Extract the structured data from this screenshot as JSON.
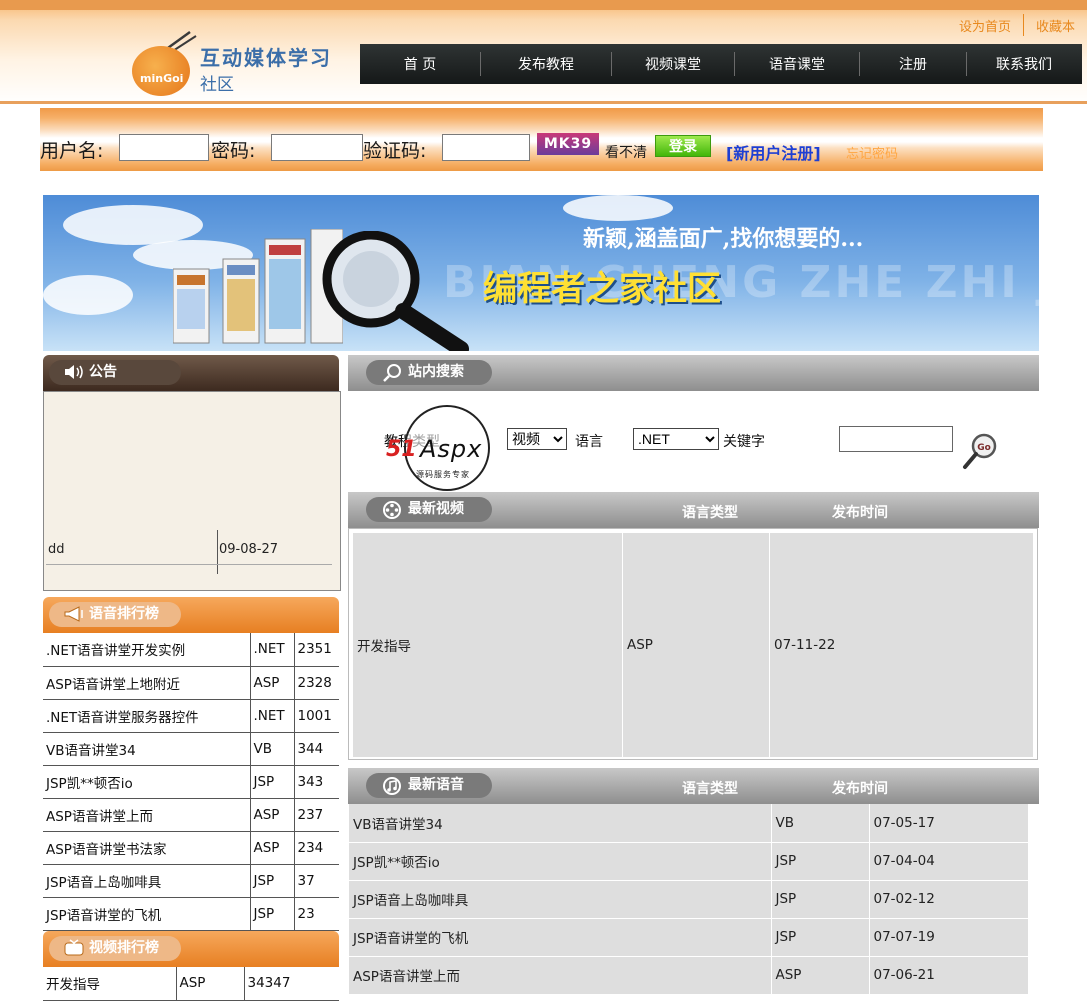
{
  "header": {
    "top_links": [
      "设为首页",
      "收藏本"
    ],
    "logo": {
      "brand": "minGoi",
      "title": "互动媒体学习",
      "subtitle": "社区"
    },
    "nav": [
      "首 页",
      "发布教程",
      "视频课堂",
      "语音课堂",
      "注册",
      "联系我们"
    ]
  },
  "login": {
    "username_label": "用户名:",
    "password_label": "密码:",
    "captcha_label": "验证码:",
    "captcha_code": "MK39",
    "unclear_text": "看不清",
    "login_button": "登录",
    "register_link": "[新用户注册]",
    "forgot_link": "忘记密码"
  },
  "banner": {
    "slogan": "新颖,涵盖面广,找你想要的...",
    "title": "编程者之家社区",
    "pinyin": "BIAN CHENG ZHE ZHI JI"
  },
  "notice": {
    "title": "公告",
    "items": [
      {
        "text": "dd",
        "date": "09-08-27"
      }
    ]
  },
  "voice_rank": {
    "title": "语音排行榜",
    "rows": [
      [
        ".NET语音讲堂开发实例",
        ".NET",
        "2351"
      ],
      [
        "ASP语音讲堂上地附近",
        "ASP",
        "2328"
      ],
      [
        ".NET语音讲堂服务器控件",
        ".NET",
        "1001"
      ],
      [
        "VB语音讲堂34",
        "VB",
        "344"
      ],
      [
        "JSP凯**顿否io",
        "JSP",
        "343"
      ],
      [
        "ASP语音讲堂上而",
        "ASP",
        "237"
      ],
      [
        "ASP语音讲堂书法家",
        "ASP",
        "234"
      ],
      [
        "JSP语音上岛咖啡具",
        "JSP",
        "37"
      ],
      [
        "JSP语音讲堂的飞机",
        "JSP",
        "23"
      ]
    ]
  },
  "video_rank": {
    "title": "视频排行榜",
    "rows": [
      [
        "开发指导",
        "ASP",
        "34347"
      ]
    ]
  },
  "search": {
    "title": "站内搜索",
    "type_label": "教程类型",
    "type_value": "视频",
    "lang_label": "语言",
    "lang_value": ".NET",
    "keyword_label": "关键字",
    "keyword_value": "",
    "go_label": "Go"
  },
  "watermark": {
    "num": "51",
    "word": "Aspx",
    "tiny": "源码服务专家"
  },
  "latest_video": {
    "title": "最新视频",
    "col_lang": "语言类型",
    "col_date": "发布时间",
    "rows": [
      [
        "开发指导",
        "ASP",
        "07-11-22"
      ]
    ]
  },
  "latest_audio": {
    "title": "最新语音",
    "col_lang": "语言类型",
    "col_date": "发布时间",
    "rows": [
      [
        "VB语音讲堂34",
        "VB",
        "07-05-17"
      ],
      [
        "JSP凯**顿否io",
        "JSP",
        "07-04-04"
      ],
      [
        "JSP语音上岛咖啡具",
        "JSP",
        "07-02-12"
      ],
      [
        "JSP语音讲堂的飞机",
        "JSP",
        "07-07-19"
      ],
      [
        "ASP语音讲堂上而",
        "ASP",
        "07-06-21"
      ]
    ]
  },
  "colors": {
    "accent_orange": "#ee9a46",
    "nav_dark": "#1d2121",
    "link_blue": "#1e3fd3",
    "login_green": "#43b60a"
  }
}
